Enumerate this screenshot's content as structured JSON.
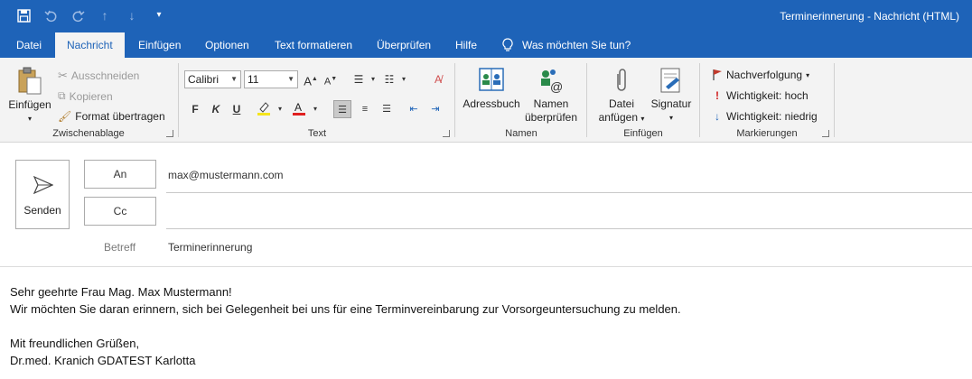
{
  "window": {
    "title": "Terminerinnerung  -  Nachricht (HTML)"
  },
  "quick_access": [
    {
      "icon": "save-icon"
    },
    {
      "icon": "undo-icon"
    },
    {
      "icon": "redo-icon"
    },
    {
      "icon": "arrow-up-icon"
    },
    {
      "icon": "arrow-down-icon"
    },
    {
      "icon": "customize-dropdown-icon"
    }
  ],
  "tabs": [
    "Datei",
    "Nachricht",
    "Einfügen",
    "Optionen",
    "Text formatieren",
    "Überprüfen",
    "Hilfe"
  ],
  "active_tab": "Nachricht",
  "tell_me": "Was möchten Sie tun?",
  "ribbon": {
    "clipboard": {
      "label": "Zwischenablage",
      "paste": "Einfügen",
      "cut": "Ausschneiden",
      "copy": "Kopieren",
      "format_painter": "Format übertragen"
    },
    "text": {
      "label": "Text",
      "font": "Calibri",
      "size": "11",
      "bold": "F",
      "italic": "K",
      "underline": "U"
    },
    "names": {
      "label": "Namen",
      "address_book": "Adressbuch",
      "check_names_1": "Namen",
      "check_names_2": "überprüfen"
    },
    "insert": {
      "label": "Einfügen",
      "attach_1": "Datei",
      "attach_2": "anfügen",
      "signature": "Signatur"
    },
    "tags": {
      "label": "Markierungen",
      "followup": "Nachverfolgung",
      "high": "Wichtigkeit: hoch",
      "low": "Wichtigkeit: niedrig"
    }
  },
  "compose": {
    "send": "Senden",
    "to_label": "An",
    "to_value": "max@mustermann.com",
    "cc_label": "Cc",
    "cc_value": "",
    "subject_label": "Betreff",
    "subject_value": "Terminerinnerung"
  },
  "body_lines": [
    "Sehr geehrte Frau Mag. Max Mustermann!",
    "Wir möchten Sie daran erinnern, sich bei Gelegenheit bei uns für eine Terminvereinbarung zur Vorsorgeuntersuchung zu melden.",
    "",
    "Mit freundlichen Grüßen,",
    "Dr.med. Kranich GDATEST Karlotta"
  ],
  "colors": {
    "accent": "#1e63b8",
    "ribbon_bg": "#f3f3f3",
    "highlight_yellow": "#f5e51c",
    "font_red": "#e02020",
    "flag_red": "#c0392b",
    "importance_blue": "#1e63b8"
  }
}
